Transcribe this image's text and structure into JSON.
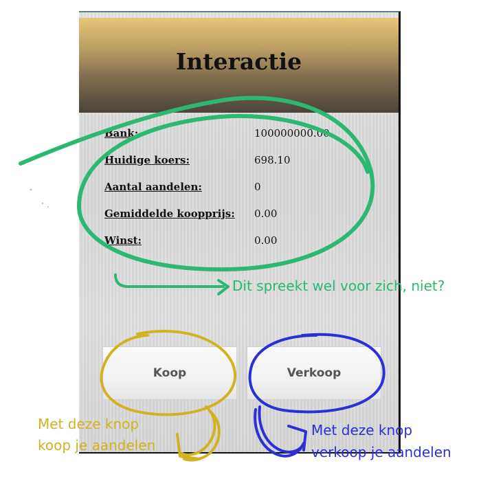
{
  "header": {
    "title": "Interactie"
  },
  "stats": [
    {
      "label": "Bank:",
      "value": "100000000.00"
    },
    {
      "label": "Huidige koers:",
      "value": "698.10"
    },
    {
      "label": "Aantal aandelen:",
      "value": "0"
    },
    {
      "label": "Gemiddelde koopprijs:",
      "value": "0.00"
    },
    {
      "label": "Winst:",
      "value": "0.00"
    }
  ],
  "buttons": {
    "buy_label": "Koop",
    "sell_label": "Verkoop"
  },
  "annotations": {
    "stats_note": "Dit spreekt wel voor zich, niet?",
    "buy_note_line1": "Met deze knop",
    "buy_note_line2": "koop je aandelen",
    "sell_note_line1": "Met deze knop",
    "sell_note_line2": "verkoop je aandelen"
  },
  "colors": {
    "annotation_green": "#2cb872",
    "annotation_yellow": "#d1b321",
    "annotation_blue": "#2a2fd6"
  }
}
